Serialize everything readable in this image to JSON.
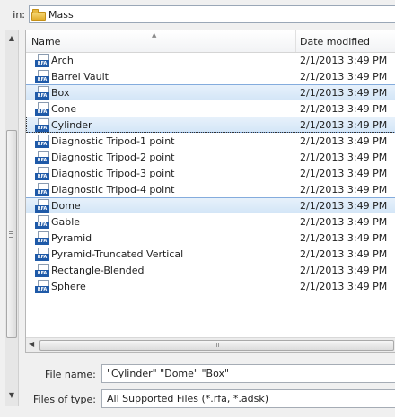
{
  "look_in": {
    "label": "in:",
    "folder": "Mass",
    "folder_icon": "folder-icon"
  },
  "list": {
    "columns": {
      "name": "Name",
      "date_modified": "Date modified"
    },
    "sort": "name-ascending",
    "file_icon": "rfa-file-icon",
    "file_icon_tag": "RFA",
    "rows": [
      {
        "name": "Arch",
        "date": "2/1/2013 3:49 PM",
        "selected": false
      },
      {
        "name": "Barrel Vault",
        "date": "2/1/2013 3:49 PM",
        "selected": false
      },
      {
        "name": "Box",
        "date": "2/1/2013 3:49 PM",
        "selected": true
      },
      {
        "name": "Cone",
        "date": "2/1/2013 3:49 PM",
        "selected": false
      },
      {
        "name": "Cylinder",
        "date": "2/1/2013 3:49 PM",
        "selected": true,
        "focused": true
      },
      {
        "name": "Diagnostic Tripod-1 point",
        "date": "2/1/2013 3:49 PM",
        "selected": false
      },
      {
        "name": "Diagnostic Tripod-2 point",
        "date": "2/1/2013 3:49 PM",
        "selected": false
      },
      {
        "name": "Diagnostic Tripod-3 point",
        "date": "2/1/2013 3:49 PM",
        "selected": false
      },
      {
        "name": "Diagnostic Tripod-4 point",
        "date": "2/1/2013 3:49 PM",
        "selected": false
      },
      {
        "name": "Dome",
        "date": "2/1/2013 3:49 PM",
        "selected": true
      },
      {
        "name": "Gable",
        "date": "2/1/2013 3:49 PM",
        "selected": false
      },
      {
        "name": "Pyramid",
        "date": "2/1/2013 3:49 PM",
        "selected": false
      },
      {
        "name": "Pyramid-Truncated Vertical",
        "date": "2/1/2013 3:49 PM",
        "selected": false
      },
      {
        "name": "Rectangle-Blended",
        "date": "2/1/2013 3:49 PM",
        "selected": false
      },
      {
        "name": "Sphere",
        "date": "2/1/2013 3:49 PM",
        "selected": false
      }
    ],
    "hscroll_grip": "III"
  },
  "file_name": {
    "label": "File name:",
    "value": "\"Cylinder\" \"Dome\" \"Box\""
  },
  "file_type": {
    "label": "Files of type:",
    "value": "All Supported Files  (*.rfa, *.adsk)"
  },
  "colors": {
    "selection_fill": "#dce9f7",
    "selection_border": "#84acdd",
    "rfa_tag": "#1f5aa8",
    "folder": "#e8b93e"
  }
}
